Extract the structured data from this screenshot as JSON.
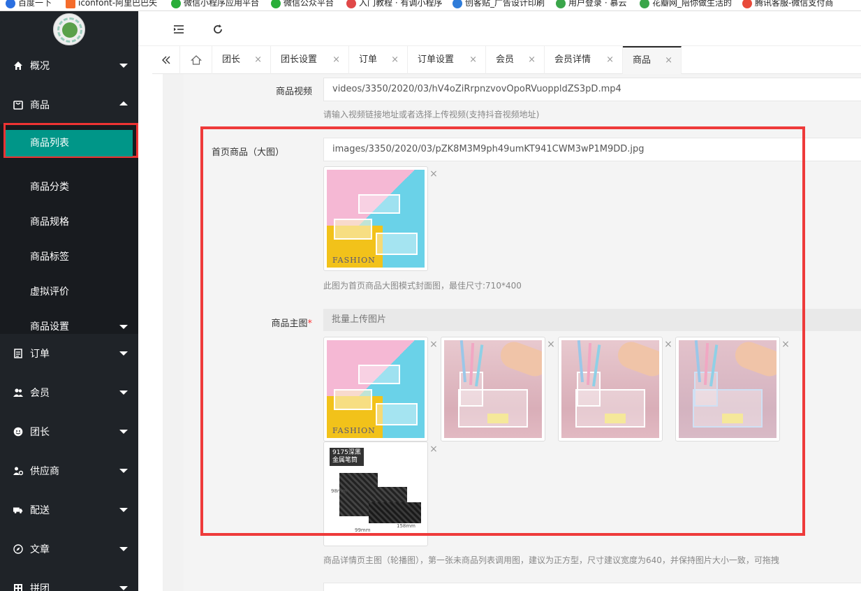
{
  "bookmarks": [
    "百度一下",
    "iconfont-阿里巴巴矢",
    "微信小程序应用平台",
    "微信公众平台",
    "入门教程 · 有调小程序",
    "创客贴_广告设计印刷",
    "用户登录 · 慕云",
    "花瓣网_陪你做生活的",
    "腾讯客服-微信支付商"
  ],
  "sidebar": {
    "menu": [
      {
        "label": "概况",
        "icon": "home-icon"
      },
      {
        "label": "商品",
        "icon": "goods-icon"
      },
      {
        "label": "订单",
        "icon": "order-icon"
      },
      {
        "label": "会员",
        "icon": "member-icon"
      },
      {
        "label": "团长",
        "icon": "leader-icon"
      },
      {
        "label": "供应商",
        "icon": "supplier-icon"
      },
      {
        "label": "配送",
        "icon": "delivery-icon"
      },
      {
        "label": "文章",
        "icon": "article-icon"
      },
      {
        "label": "拼团",
        "icon": "group-icon"
      }
    ],
    "submenu": [
      "商品列表",
      "商品分类",
      "商品规格",
      "商品标签",
      "虚拟评价",
      "商品设置"
    ]
  },
  "tabs": [
    "团长",
    "团长设置",
    "订单",
    "订单设置",
    "会员",
    "会员详情",
    "商品"
  ],
  "form": {
    "video_label": "商品视频",
    "video_value": "videos/3350/2020/03/hV4oZiRrpnzvovOpoRVuoppldZS3pD.mp4",
    "video_hint": "请输入视频链接地址或者选择上传视频(支持抖音视频地址)",
    "cover_label": "首页商品（大图）",
    "cover_value": "images/3350/2020/03/pZK8M3M9ph49umKT941CWM3wP1M9DD.jpg",
    "cover_hint": "此图为首页商品大图模式封面图，最佳尺寸:710*400",
    "main_label": "商品主图",
    "required_mark": "*",
    "upload_label": "批量上传图片",
    "main_hint": "商品详情页主图（轮播图），第一张未商品列表调用图，建议为正方型，尺寸建议宽度为640，并保持图片大小一致，可拖拽",
    "fashion_word": "FASHION",
    "black_tag_line1": "9175深黑",
    "black_tag_line2": "金属笔筒",
    "dim_h": "98mm",
    "dim_w": "158mm",
    "dim_side": "99mm",
    "remove_glyph": "×"
  },
  "colors": {
    "sidebar_bg": "#1f2328",
    "active": "#009688",
    "highlight": "#ee3a3a"
  }
}
